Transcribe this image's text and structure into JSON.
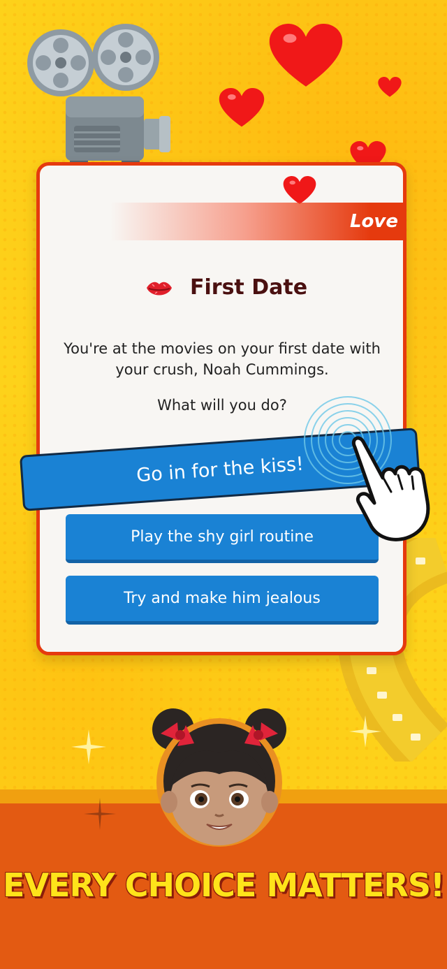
{
  "card": {
    "category": "Love",
    "title": "First Date",
    "description": "You're at the movies on your first date with your crush, Noah Cummings.",
    "prompt": "What will you do?"
  },
  "choices": [
    {
      "label": "Go in for the kiss!"
    },
    {
      "label": "Play the shy girl routine"
    },
    {
      "label": "Try and make him jealous"
    }
  ],
  "tagline": "EVERY CHOICE MATTERS!",
  "icons": [
    "film-projector-icon",
    "heart-icon",
    "kiss-lips-icon",
    "tap-hand-icon",
    "film-strip-icon",
    "avatar-girl-icon",
    "sparkle-icon"
  ],
  "colors": {
    "background": "#fdd21a",
    "card_border": "#e53a0e",
    "choice_button": "#1a82d4",
    "title_text": "#4a1010",
    "tagline_text": "#ffe31a",
    "bottom_band": "#e35a12"
  }
}
